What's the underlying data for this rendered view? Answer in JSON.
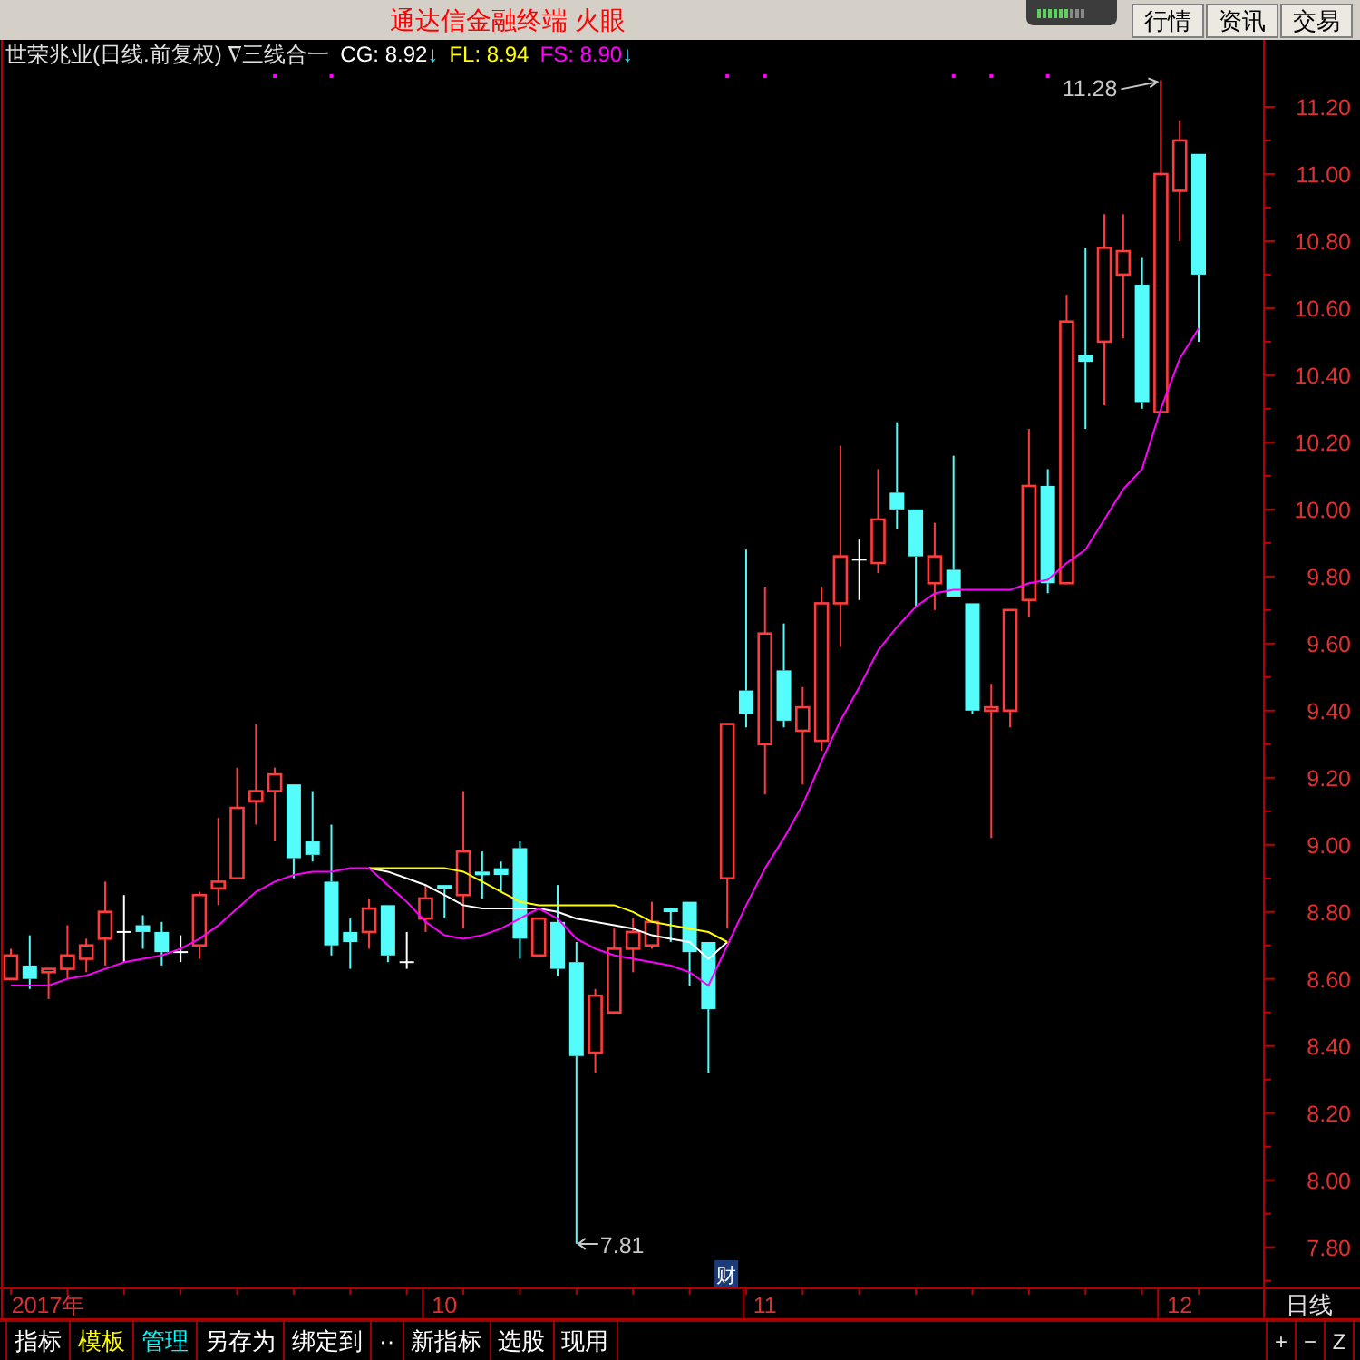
{
  "window": {
    "title": "通达信金融终端 火眼"
  },
  "top_buttons": [
    {
      "label": "行情"
    },
    {
      "label": "资讯"
    },
    {
      "label": "交易"
    }
  ],
  "chart_header": {
    "title": "世荣兆业(日线.前复权) ∇三线合一",
    "trend_arrows": [
      "↓",
      null,
      "↓"
    ]
  },
  "chart": {
    "chart_data": {
      "type": "candlestick",
      "ylim": [
        7.68,
        11.4
      ],
      "categories": [
        null,
        null,
        "2017年",
        null,
        null,
        null,
        null,
        null,
        null,
        null,
        null,
        null,
        null,
        null,
        null,
        null,
        null,
        null,
        null,
        null,
        null,
        null,
        null,
        "10",
        null,
        null,
        null,
        null,
        null,
        null,
        null,
        null,
        null,
        null,
        null,
        null,
        null,
        null,
        null,
        null,
        "11",
        null,
        null,
        null,
        null,
        null,
        null,
        null,
        null,
        null,
        null,
        null,
        null,
        null,
        null,
        null,
        null,
        null,
        null,
        null,
        null,
        null,
        "12",
        null
      ],
      "yticks": [
        {
          "value": 11.2,
          "label": "11.20"
        },
        {
          "value": 11.0,
          "label": "11.00"
        },
        {
          "value": 10.8,
          "label": "10.80"
        },
        {
          "value": 10.6,
          "label": "10.60"
        },
        {
          "value": 10.4,
          "label": "10.40"
        },
        {
          "value": 10.2,
          "label": "10.20"
        },
        {
          "value": 10.0,
          "label": "10.00"
        },
        {
          "value": 9.8,
          "label": "9.80"
        },
        {
          "value": 9.6,
          "label": "9.60"
        },
        {
          "value": 9.4,
          "label": "9.40"
        },
        {
          "value": 9.2,
          "label": "9.20"
        },
        {
          "value": 9.0,
          "label": "9.00"
        },
        {
          "value": 8.8,
          "label": "8.80"
        },
        {
          "value": 8.6,
          "label": "8.60"
        },
        {
          "value": 8.4,
          "label": "8.40"
        },
        {
          "value": 8.2,
          "label": "8.20"
        },
        {
          "value": 8.0,
          "label": "8.00"
        },
        {
          "value": 7.8,
          "label": "7.80"
        }
      ],
      "ohlc": [
        [
          8.6,
          8.69,
          8.6,
          8.67
        ],
        [
          8.64,
          8.73,
          8.57,
          8.6
        ],
        [
          8.62,
          8.63,
          8.54,
          8.63
        ],
        [
          8.63,
          8.76,
          8.6,
          8.67
        ],
        [
          8.66,
          8.72,
          8.62,
          8.7
        ],
        [
          8.72,
          8.89,
          8.64,
          8.8
        ],
        [
          8.74,
          8.85,
          8.65,
          8.74
        ],
        [
          8.76,
          8.79,
          8.69,
          8.74
        ],
        [
          8.74,
          8.77,
          8.64,
          8.68
        ],
        [
          8.68,
          8.73,
          8.65,
          8.68
        ],
        [
          8.7,
          8.86,
          8.66,
          8.85
        ],
        [
          8.87,
          9.08,
          8.82,
          8.89
        ],
        [
          8.9,
          9.23,
          8.9,
          9.11
        ],
        [
          9.13,
          9.36,
          9.06,
          9.16
        ],
        [
          9.16,
          9.23,
          9.01,
          9.21
        ],
        [
          9.18,
          9.18,
          8.9,
          8.96
        ],
        [
          9.01,
          9.16,
          8.95,
          8.97
        ],
        [
          8.89,
          9.06,
          8.67,
          8.7
        ],
        [
          8.74,
          8.78,
          8.63,
          8.71
        ],
        [
          8.74,
          8.84,
          8.69,
          8.81
        ],
        [
          8.82,
          8.82,
          8.65,
          8.67
        ],
        [
          8.65,
          8.74,
          8.63,
          8.65
        ],
        [
          8.78,
          8.88,
          8.74,
          8.84
        ],
        [
          8.88,
          8.88,
          8.78,
          8.87
        ],
        [
          8.85,
          9.16,
          8.75,
          8.98
        ],
        [
          8.92,
          8.98,
          8.84,
          8.91
        ],
        [
          8.93,
          8.95,
          8.86,
          8.91
        ],
        [
          8.99,
          9.01,
          8.66,
          8.72
        ],
        [
          8.67,
          8.78,
          8.67,
          8.78
        ],
        [
          8.77,
          8.88,
          8.61,
          8.63
        ],
        [
          8.65,
          8.71,
          7.81,
          8.37
        ],
        [
          8.38,
          8.57,
          8.32,
          8.55
        ],
        [
          8.5,
          8.75,
          8.5,
          8.69
        ],
        [
          8.69,
          8.78,
          8.62,
          8.74
        ],
        [
          8.7,
          8.83,
          8.69,
          8.77
        ],
        [
          8.81,
          8.81,
          8.71,
          8.8
        ],
        [
          8.83,
          8.83,
          8.58,
          8.68
        ],
        [
          8.71,
          8.71,
          8.32,
          8.51
        ],
        [
          8.9,
          9.36,
          8.75,
          9.36
        ],
        [
          9.46,
          9.88,
          9.35,
          9.39
        ],
        [
          9.3,
          9.77,
          9.15,
          9.63
        ],
        [
          9.52,
          9.66,
          9.35,
          9.37
        ],
        [
          9.34,
          9.47,
          9.18,
          9.41
        ],
        [
          9.31,
          9.77,
          9.28,
          9.72
        ],
        [
          9.72,
          10.19,
          9.59,
          9.86
        ],
        [
          9.85,
          9.91,
          9.73,
          9.85
        ],
        [
          9.84,
          10.12,
          9.81,
          9.97
        ],
        [
          10.05,
          10.26,
          9.94,
          10.0
        ],
        [
          10.0,
          10.0,
          9.71,
          9.86
        ],
        [
          9.78,
          9.96,
          9.7,
          9.86
        ],
        [
          9.82,
          10.16,
          9.74,
          9.74
        ],
        [
          9.72,
          9.72,
          9.39,
          9.4
        ],
        [
          9.4,
          9.48,
          9.02,
          9.41
        ],
        [
          9.4,
          9.7,
          9.35,
          9.7
        ],
        [
          9.73,
          10.24,
          9.68,
          10.07
        ],
        [
          10.07,
          10.12,
          9.75,
          9.78
        ],
        [
          9.78,
          10.64,
          9.78,
          10.56
        ],
        [
          10.46,
          10.78,
          10.24,
          10.44
        ],
        [
          10.5,
          10.88,
          10.31,
          10.78
        ],
        [
          10.7,
          10.88,
          10.51,
          10.77
        ],
        [
          10.67,
          10.75,
          10.3,
          10.32
        ],
        [
          10.29,
          11.28,
          10.29,
          11.0
        ],
        [
          10.95,
          11.16,
          10.8,
          11.1
        ],
        [
          11.06,
          11.06,
          10.5,
          10.7
        ]
      ],
      "series": [
        {
          "name": "CG: 8.92",
          "type": "line",
          "color": "#ffffff",
          "values": [
            null,
            null,
            null,
            null,
            null,
            null,
            null,
            null,
            null,
            null,
            null,
            null,
            null,
            null,
            null,
            null,
            null,
            null,
            null,
            8.93,
            8.92,
            8.9,
            8.88,
            8.85,
            8.82,
            8.81,
            8.81,
            8.81,
            8.81,
            8.8,
            8.78,
            8.77,
            8.76,
            8.75,
            8.73,
            8.72,
            8.71,
            8.66,
            8.71,
            null,
            null,
            null,
            null,
            null,
            null,
            null,
            null,
            null,
            null,
            null,
            null,
            null,
            null,
            null,
            null,
            null,
            null,
            null,
            null,
            null,
            null,
            null,
            null,
            null
          ]
        },
        {
          "name": "FL: 8.94",
          "type": "line",
          "color": "#ffff00",
          "values": [
            null,
            null,
            null,
            null,
            null,
            null,
            null,
            null,
            null,
            null,
            null,
            null,
            null,
            null,
            null,
            null,
            null,
            null,
            null,
            8.93,
            8.93,
            8.93,
            8.93,
            8.93,
            8.92,
            8.89,
            8.86,
            8.83,
            8.82,
            8.82,
            8.82,
            8.82,
            8.82,
            8.8,
            8.77,
            8.76,
            8.75,
            8.74,
            8.71,
            null,
            null,
            null,
            null,
            null,
            null,
            null,
            null,
            null,
            null,
            null,
            null,
            null,
            null,
            null,
            null,
            null,
            null,
            null,
            null,
            null,
            null,
            null,
            null,
            null
          ]
        },
        {
          "name": "FS: 8.90",
          "type": "line",
          "color": "#ff00ff",
          "values": [
            8.58,
            8.58,
            8.58,
            8.6,
            8.61,
            8.63,
            8.65,
            8.66,
            8.67,
            8.69,
            8.72,
            8.76,
            8.81,
            8.86,
            8.89,
            8.91,
            8.92,
            8.92,
            8.93,
            8.93,
            8.88,
            8.83,
            8.77,
            8.73,
            8.72,
            8.73,
            8.75,
            8.78,
            8.81,
            8.78,
            8.72,
            8.69,
            8.67,
            8.66,
            8.65,
            8.64,
            8.62,
            8.58,
            8.7,
            8.82,
            8.93,
            9.02,
            9.12,
            9.25,
            9.37,
            9.47,
            9.58,
            9.65,
            9.71,
            9.75,
            9.76,
            9.76,
            9.76,
            9.76,
            9.78,
            9.79,
            9.84,
            9.88,
            9.97,
            10.06,
            10.12,
            10.3,
            10.45,
            10.54
          ]
        }
      ],
      "annotations": [
        "11.28",
        "7.81"
      ]
    },
    "event_badge": {
      "label": "财"
    },
    "period_label": "日线"
  },
  "toolbar": {
    "buttons": [
      {
        "label": "指标",
        "kind": "plain"
      },
      {
        "label": "模板",
        "kind": "accent"
      },
      {
        "label": "管理",
        "kind": "active"
      },
      {
        "label": "另存为",
        "kind": "plain"
      },
      {
        "label": "绑定到",
        "kind": "plain"
      },
      {
        "label": "··",
        "kind": "plain"
      },
      {
        "label": "新指标",
        "kind": "plain"
      },
      {
        "label": "选股",
        "kind": "plain"
      },
      {
        "label": "现用",
        "kind": "plain"
      }
    ],
    "right_buttons": [
      {
        "label": "+"
      },
      {
        "label": "−"
      },
      {
        "label": "Z"
      }
    ]
  }
}
